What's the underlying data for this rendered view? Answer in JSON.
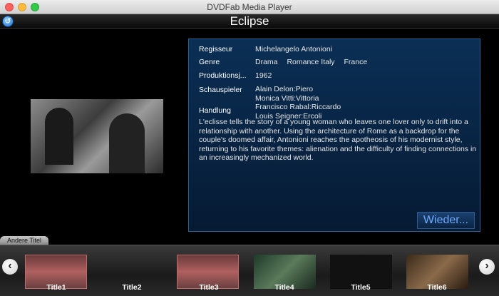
{
  "window": {
    "title": "DVDFab Media Player"
  },
  "header": {
    "title": "Eclipse"
  },
  "details": {
    "director_label": "Regisseur",
    "director": "Michelangelo Antonioni",
    "genre_label": "Genre",
    "genres": [
      "Drama",
      "Romance Italy",
      "France"
    ],
    "year_label": "Produktionsj...",
    "year": "1962",
    "cast_label": "Schauspieler",
    "cast": [
      "Alain Delon:Piero",
      "Monica Vitti:Vittoria",
      "Francisco Rabal:Riccardo",
      "Louis Seigner:Ercoli"
    ],
    "plot_label": "Handlung",
    "plot": "L'eclisse tells the story of a young woman who leaves one lover only to drift into a relationship with another. Using the architecture of Rome as a backdrop for the couple's doomed affair, Antonioni reaches the apotheosis of his modernist style, returning to his favorite themes: alienation and the difficulty of finding connections in an increasingly mechanized world.",
    "replay_label": "Wieder..."
  },
  "others": {
    "tab_label": "Andere Titel",
    "titles": [
      "Title1",
      "Title2",
      "Title3",
      "Title4",
      "Title5",
      "Title6"
    ]
  }
}
